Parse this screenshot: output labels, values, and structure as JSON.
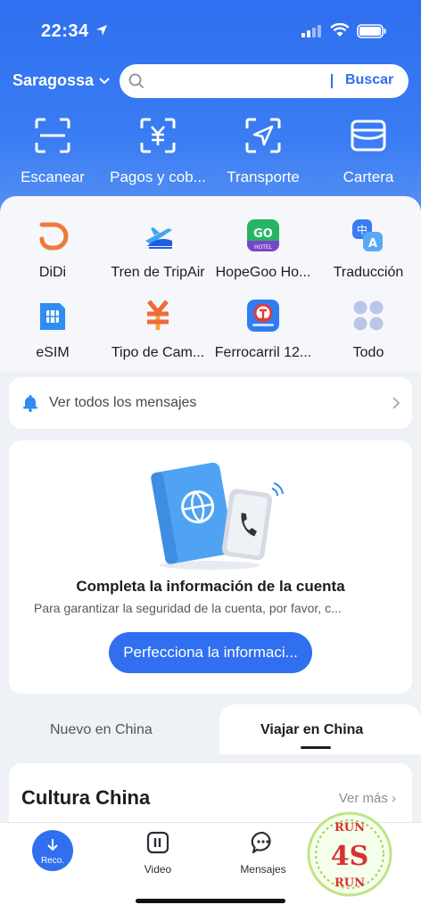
{
  "status_bar": {
    "time": "22:34"
  },
  "header": {
    "city": "Saragossa",
    "search_placeholder": "",
    "search_button": "Buscar"
  },
  "quick_actions": [
    {
      "label": "Escanear",
      "icon": "scan-icon"
    },
    {
      "label": "Pagos y cob...",
      "icon": "yuan-payment-icon"
    },
    {
      "label": "Transporte",
      "icon": "navigation-arrow-icon"
    },
    {
      "label": "Cartera",
      "icon": "wallet-icon"
    }
  ],
  "services": [
    {
      "label": "DiDi",
      "icon": "didi-icon"
    },
    {
      "label": "Tren de TripAir",
      "icon": "train-plane-icon"
    },
    {
      "label": "HopeGoo Ho...",
      "icon": "hopegoo-hotel-icon"
    },
    {
      "label": "Traducción",
      "icon": "translate-icon"
    },
    {
      "label": "eSIM",
      "icon": "esim-icon"
    },
    {
      "label": "Tipo de Cam...",
      "icon": "exchange-rate-icon"
    },
    {
      "label": "Ferrocarril 12...",
      "icon": "railway-12306-icon"
    },
    {
      "label": "Todo",
      "icon": "grid-all-icon"
    }
  ],
  "messages_bar": {
    "label": "Ver todos los mensajes"
  },
  "account_card": {
    "title": "Completa la información de la cuenta",
    "subtitle": "Para garantizar la seguridad de la cuenta, por favor, c...",
    "button": "Perfecciona la informaci..."
  },
  "feed_tabs": [
    {
      "label": "Nuevo en China",
      "active": false
    },
    {
      "label": "Viajar en China",
      "active": true
    }
  ],
  "culture_section": {
    "title": "Cultura China",
    "more": "Ver más"
  },
  "tab_bar": [
    {
      "label": "Reco.",
      "icon": "download-arrow-icon",
      "active": true
    },
    {
      "label": "Video",
      "icon": "video-icon",
      "active": false
    },
    {
      "label": "Mensajes",
      "icon": "chat-bubble-icon",
      "active": false
    }
  ],
  "watermark": {
    "text_top": "RUN",
    "text_mid": "4S",
    "text_bottom": "RUN"
  },
  "colors": {
    "primary": "#2f6ff0",
    "background": "#eef1f6"
  }
}
